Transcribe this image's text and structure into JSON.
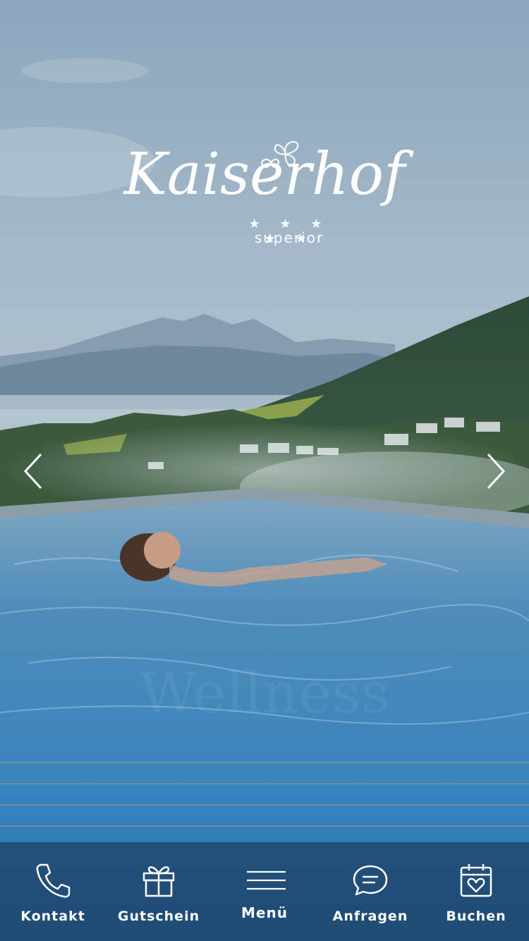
{
  "brand": {
    "name": "Kaiserhof",
    "stars": "★ ★ ★ ★ ★",
    "tagline": "superior"
  },
  "hero": {
    "prev_icon": "chevron-left-icon",
    "next_icon": "chevron-right-icon"
  },
  "bottom_nav": {
    "items": [
      {
        "label": "Kontakt",
        "icon": "phone-icon"
      },
      {
        "label": "Gutschein",
        "icon": "gift-icon"
      },
      {
        "label": "Menü",
        "icon": "hamburger-menu-icon"
      },
      {
        "label": "Anfragen",
        "icon": "chat-bubble-icon"
      },
      {
        "label": "Buchen",
        "icon": "calendar-heart-icon"
      }
    ]
  },
  "colors": {
    "nav_background": "#1c3e62",
    "icon_color": "#ffffff",
    "sky_top": "#9fb6c9",
    "water": "#3f8fc4"
  }
}
